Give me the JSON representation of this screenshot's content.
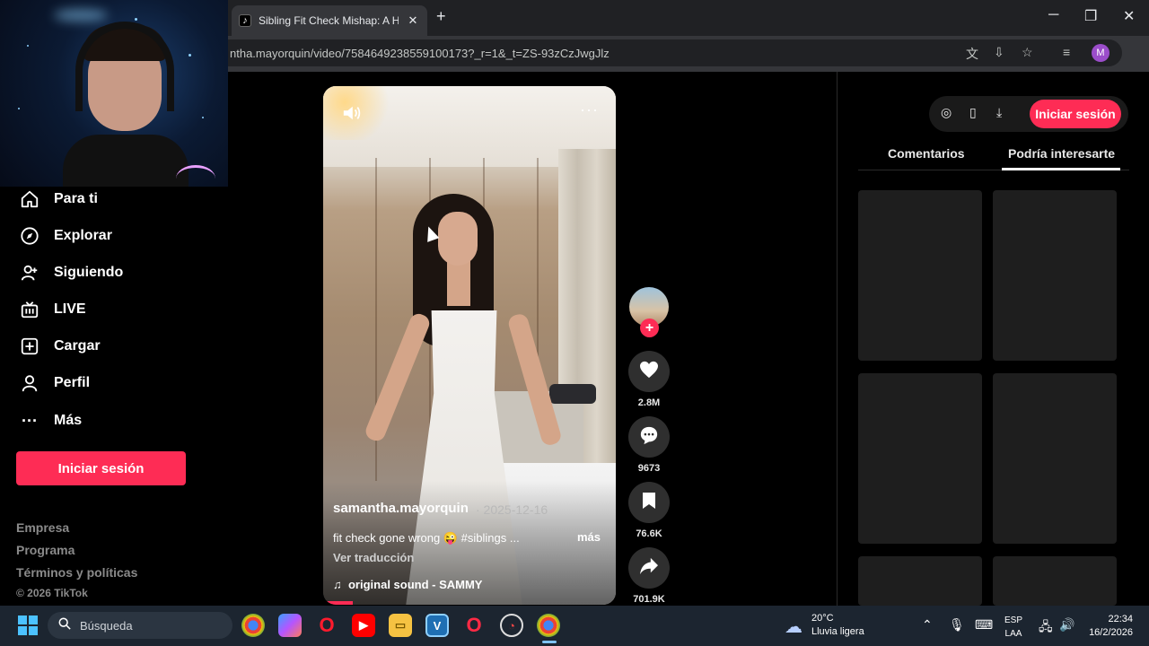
{
  "browser": {
    "tab_title": "Sibling Fit Check Mishap: A Hila",
    "tab_close": "✕",
    "new_tab": "+",
    "url": "ntha.mayorquin/video/7584649238559100173?_r=1&_t=ZS-93zCzJwgJlz",
    "profile_initial": "M",
    "window_controls": [
      "─",
      "❐",
      "✕"
    ]
  },
  "sidebar": {
    "items": [
      {
        "label": "Para ti",
        "icon": "home-icon"
      },
      {
        "label": "Explorar",
        "icon": "compass-icon"
      },
      {
        "label": "Siguiendo",
        "icon": "user-follow-icon"
      },
      {
        "label": "LIVE",
        "icon": "live-tv-icon"
      },
      {
        "label": "Cargar",
        "icon": "upload-plus-icon"
      },
      {
        "label": "Perfil",
        "icon": "profile-icon"
      },
      {
        "label": "Más",
        "icon": "more-dots-icon"
      }
    ],
    "login_label": "Iniciar sesión",
    "footer_links": [
      "Empresa",
      "Programa",
      "Términos y políticas"
    ],
    "copyright": "© 2026 TikTok"
  },
  "video": {
    "author": "samantha.mayorquin",
    "date": "· 2025-12-16",
    "caption": "fit check gone wrong 😜 #siblings ...",
    "more_label": "más",
    "translate_label": "Ver traducción",
    "sound": "original sound - SAMMY",
    "sound_glyph": "♫",
    "more_dots": "···",
    "progress_fraction": 0.1
  },
  "actions": {
    "likes": "2.8M",
    "comments": "9673",
    "saves": "76.6K",
    "shares": "701.9K",
    "follow_plus": "+"
  },
  "right_panel": {
    "login_label": "Iniciar sesión",
    "tabs": [
      "Comentarios",
      "Podría interesarte"
    ],
    "active_tab": "Podría interesarte"
  },
  "taskbar": {
    "search_placeholder": "Búsqueda",
    "weather_temp": "20°C",
    "weather_condition": "Lluvia ligera",
    "lang_top": "ESP",
    "lang_bottom": "LAA",
    "time": "22:34",
    "date": "16/2/2026",
    "apps": [
      "chrome-icon",
      "copilot-icon",
      "opera-icon",
      "youtube-icon",
      "file-explorer-icon",
      "vegas-icon",
      "opera-gx-icon",
      "speedometer-icon",
      "chrome-profile-icon"
    ]
  },
  "colors": {
    "accent": "#fe2c55",
    "background": "#000000"
  }
}
